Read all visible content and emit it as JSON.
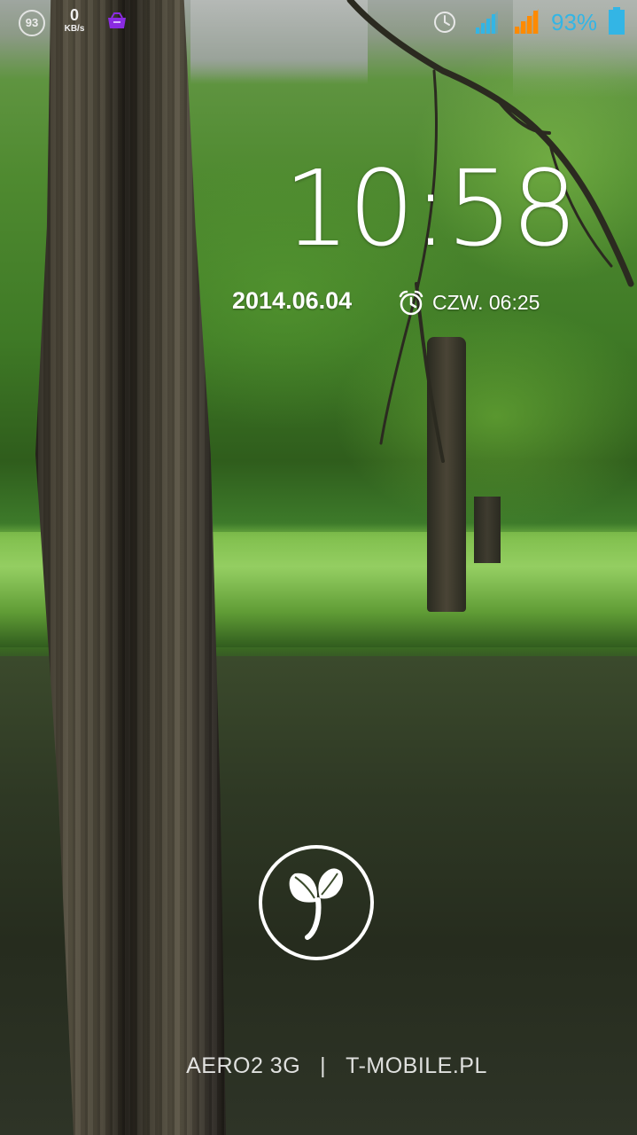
{
  "status_bar": {
    "notification_count": "93",
    "net_speed_value": "0",
    "net_speed_unit": "KB/s",
    "battery_percent": "93%",
    "icons": [
      "notification-count-badge",
      "purple-app-icon",
      "alarm-clock-icon",
      "signal-sim1-icon",
      "signal-sim2-icon",
      "battery-icon"
    ],
    "colors": {
      "signal_sim1": "#33b5e5",
      "signal_sim2": "#ff8a00",
      "battery": "#33b5e5",
      "app_icon": "#8a2be2"
    }
  },
  "lockscreen": {
    "time": "10:58",
    "date": "2014.06.04",
    "next_alarm": "CZW. 06:25",
    "unlock_icon": "sprout-icon"
  },
  "carrier": {
    "sim1": "AERO2 3G",
    "separator": "|",
    "sim2": "T-MOBILE.PL"
  }
}
